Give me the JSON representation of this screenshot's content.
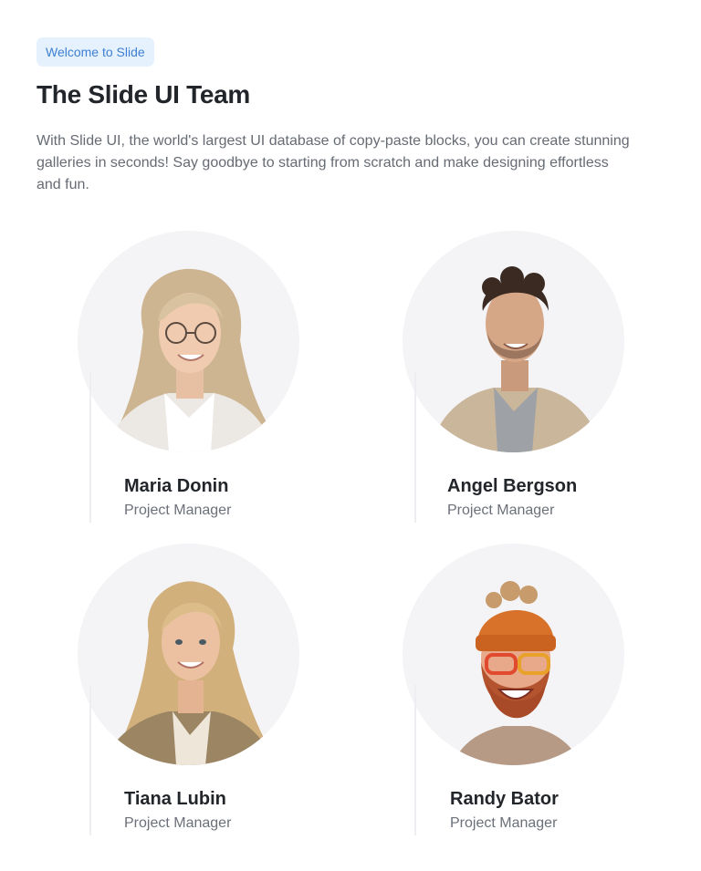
{
  "header": {
    "badge": "Welcome to Slide",
    "title": "The Slide UI Team",
    "description": "With Slide UI, the world's largest UI database of copy-paste blocks, you can create stunning galleries in seconds! Say goodbye to starting from scratch and make designing effortless and fun."
  },
  "team": [
    {
      "name": "Maria Donin",
      "role": "Project Manager"
    },
    {
      "name": "Angel Bergson",
      "role": "Project Manager"
    },
    {
      "name": "Tiana Lubin",
      "role": "Project Manager"
    },
    {
      "name": "Randy Bator",
      "role": "Project Manager"
    }
  ],
  "colors": {
    "badge_bg": "#e6f1fe",
    "badge_text": "#3d7fd1",
    "heading": "#22252a",
    "body_text": "#666b73",
    "avatar_bg": "#f4f4f6"
  }
}
